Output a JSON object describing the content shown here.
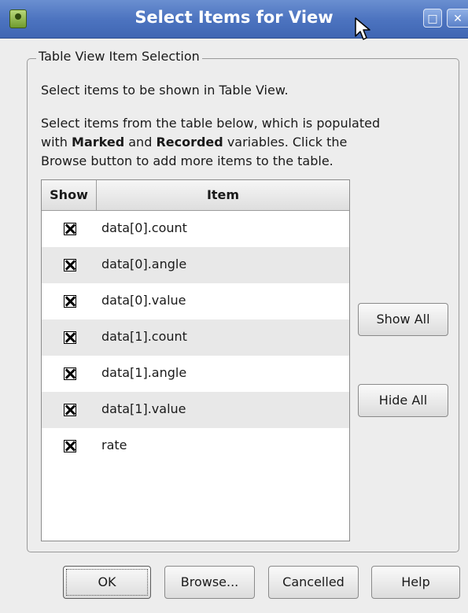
{
  "window": {
    "title": "Select Items for View",
    "restore_glyph": "□",
    "close_glyph": "✕"
  },
  "group": {
    "legend": "Table View Item Selection",
    "intro": "Select items to be shown in Table View.",
    "instructions_line1_pre": "Select items from the table below, which is populated",
    "instructions_line2_pre": "with ",
    "instructions_marked": "Marked",
    "instructions_and": " and ",
    "instructions_recorded": "Recorded",
    "instructions_line2_post": " variables. Click the",
    "instructions_line3": "Browse button to add more items to the table."
  },
  "table": {
    "columns": [
      "Show",
      "Item"
    ],
    "rows": [
      {
        "show": true,
        "item": "data[0].count"
      },
      {
        "show": true,
        "item": "data[0].angle"
      },
      {
        "show": true,
        "item": "data[0].value"
      },
      {
        "show": true,
        "item": "data[1].count"
      },
      {
        "show": true,
        "item": "data[1].angle"
      },
      {
        "show": true,
        "item": "data[1].value"
      },
      {
        "show": true,
        "item": "rate"
      }
    ]
  },
  "side_buttons": {
    "show_all": "Show All",
    "hide_all": "Hide All"
  },
  "footer": {
    "ok": "OK",
    "browse": "Browse...",
    "cancel": "Cancelled",
    "help": "Help"
  },
  "colors": {
    "titlebar": "#4d74c0",
    "background": "#ededed",
    "row_alt": "#e8e8e8"
  },
  "icons": {
    "app": "app-icon",
    "restore": "restore-icon",
    "close": "close-icon",
    "cursor": "mouse-pointer-icon"
  }
}
